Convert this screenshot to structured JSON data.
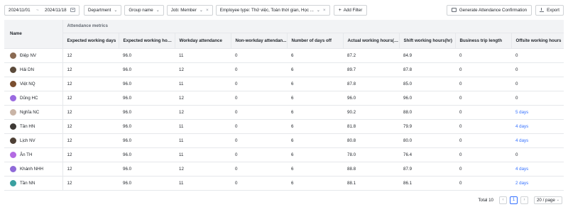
{
  "toolbar": {
    "date_start": "2024/11/01",
    "date_sep": "~",
    "date_end": "2024/11/18",
    "department": "Department",
    "group_name": "Group name",
    "job_filter": "Job: Member",
    "employee_type_filter": "Employee type: Thử việc, Toàn thời gian, Học ...",
    "add_filter": "Add Filter",
    "generate_button": "Generate Attendance Confirmation",
    "export_button": "Export"
  },
  "table": {
    "name_header": "Name",
    "group_header": "Attendance metrics",
    "columns": [
      "Expected working days",
      "Expected working hour...",
      "Workday attendance",
      "Non-workday attendan...",
      "Number of days off",
      "Actual working hours(hr)",
      "Shift working hours(hr)",
      "Business trip length",
      "Offsite working hours"
    ],
    "rows": [
      {
        "name": "Điệp NV",
        "avatar": "#8a6a52",
        "cells": [
          "12",
          "96.0",
          "11",
          "0",
          "6",
          "87.2",
          "84.9",
          "0",
          "0"
        ]
      },
      {
        "name": "Hải DN",
        "avatar": "#5b4a3a",
        "cells": [
          "12",
          "96.0",
          "12",
          "0",
          "6",
          "89.7",
          "87.8",
          "0",
          "0"
        ]
      },
      {
        "name": "Việt NQ",
        "avatar": "#7a4e2e",
        "cells": [
          "12",
          "96.0",
          "11",
          "0",
          "6",
          "87.8",
          "85.0",
          "0",
          "0"
        ]
      },
      {
        "name": "Dũng HC",
        "avatar": "#9a6ae0",
        "cells": [
          "12",
          "96.0",
          "12",
          "0",
          "6",
          "96.0",
          "96.0",
          "0",
          "0"
        ]
      },
      {
        "name": "Nghĩa NC",
        "avatar": "#c9b4a6",
        "cells": [
          "12",
          "96.0",
          "12",
          "0",
          "6",
          "90.2",
          "88.0",
          "0",
          "5 days"
        ]
      },
      {
        "name": "Tân HN",
        "avatar": "#3e3a36",
        "cells": [
          "12",
          "96.0",
          "11",
          "0",
          "6",
          "81.8",
          "79.9",
          "0",
          "4 days"
        ]
      },
      {
        "name": "Lịch NV",
        "avatar": "#4d4035",
        "cells": [
          "12",
          "96.0",
          "11",
          "0",
          "6",
          "80.8",
          "80.0",
          "0",
          "4 days"
        ]
      },
      {
        "name": "Ân TH",
        "avatar": "#b36ae2",
        "cells": [
          "12",
          "96.0",
          "11",
          "0",
          "6",
          "78.0",
          "76.4",
          "0",
          "0"
        ]
      },
      {
        "name": "Khánh NHH",
        "avatar": "#8f6ad8",
        "cells": [
          "12",
          "96.0",
          "12",
          "0",
          "6",
          "88.8",
          "87.9",
          "0",
          "4 days"
        ]
      },
      {
        "name": "Tần NN",
        "avatar": "#3aa0a0",
        "cells": [
          "12",
          "96.0",
          "11",
          "0",
          "6",
          "88.1",
          "86.1",
          "0",
          "2 days"
        ]
      }
    ]
  },
  "footer": {
    "total": "Total 10",
    "prev": "‹",
    "page": "1",
    "next": "›",
    "page_size": "20 / page"
  },
  "colors": {
    "link": "#3370ff",
    "header_bg": "#f2f3f5"
  }
}
